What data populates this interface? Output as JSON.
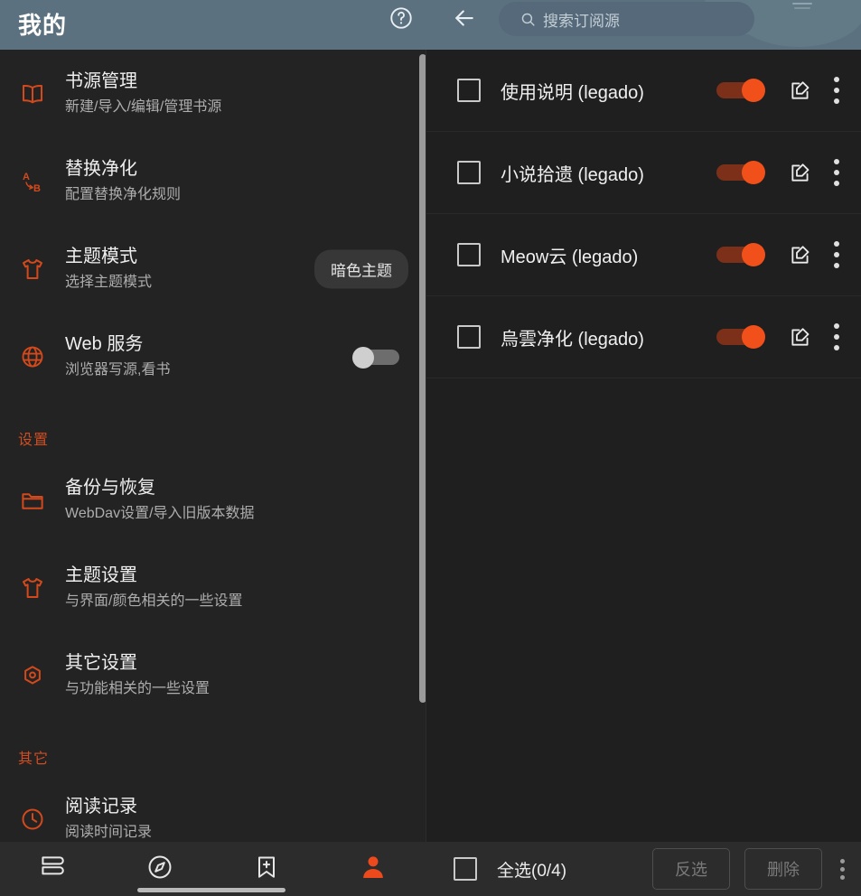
{
  "header": {
    "title": "我的",
    "help_icon": "help-circle-icon",
    "back_icon": "back-arrow-icon",
    "search": {
      "placeholder": "搜索订阅源",
      "value": "",
      "icon": "search-icon"
    },
    "background_color": "#5b7180"
  },
  "accent_color": "#cf4d22",
  "switch_on_color": "#f2501a",
  "sidebar": {
    "items": [
      {
        "title": "书源管理",
        "summary": "新建/导入/编辑/管理书源",
        "icon": "book-icon"
      },
      {
        "title": "替换净化",
        "summary": "配置替换净化规则",
        "icon": "replace-ab-icon"
      },
      {
        "title": "主题模式",
        "summary": "选择主题模式",
        "icon": "tshirt-icon",
        "chip": "暗色主题"
      },
      {
        "title": "Web 服务",
        "summary": "浏览器写源,看书",
        "icon": "globe-icon",
        "toggle": false
      }
    ],
    "section_settings": {
      "label": "设置",
      "items": [
        {
          "title": "备份与恢复",
          "summary": "WebDav设置/导入旧版本数据",
          "icon": "folder-icon"
        },
        {
          "title": "主题设置",
          "summary": "与界面/颜色相关的一些设置",
          "icon": "tshirt-icon"
        },
        {
          "title": "其它设置",
          "summary": "与功能相关的一些设置",
          "icon": "hex-gear-icon"
        }
      ]
    },
    "section_other": {
      "label": "其它",
      "items": [
        {
          "title": "阅读记录",
          "summary": "阅读时间记录",
          "icon": "clock-icon"
        }
      ]
    }
  },
  "sources": {
    "rows": [
      {
        "name": "使用说明 (legado)",
        "checked": false,
        "enabled": true
      },
      {
        "name": "小说拾遗 (legado)",
        "checked": false,
        "enabled": true
      },
      {
        "name": "Meow云 (legado)",
        "checked": false,
        "enabled": true
      },
      {
        "name": "烏雲净化 (legado)",
        "checked": false,
        "enabled": true
      }
    ],
    "row_edit_icon": "edit-square-icon",
    "row_more_icon": "more-vertical-icon"
  },
  "bottom_nav": {
    "items": [
      {
        "name": "bookshelf",
        "icon": "bookshelf-icon",
        "active": false
      },
      {
        "name": "explore",
        "icon": "compass-icon",
        "active": false
      },
      {
        "name": "subscribe",
        "icon": "bookmark-plus-icon",
        "active": false
      },
      {
        "name": "mine",
        "icon": "person-icon",
        "active": true
      }
    ]
  },
  "action_bar": {
    "select_all_label": "全选(0/4)",
    "select_all_checked": false,
    "invert_label": "反选",
    "delete_label": "删除",
    "more_icon": "more-vertical-icon"
  }
}
